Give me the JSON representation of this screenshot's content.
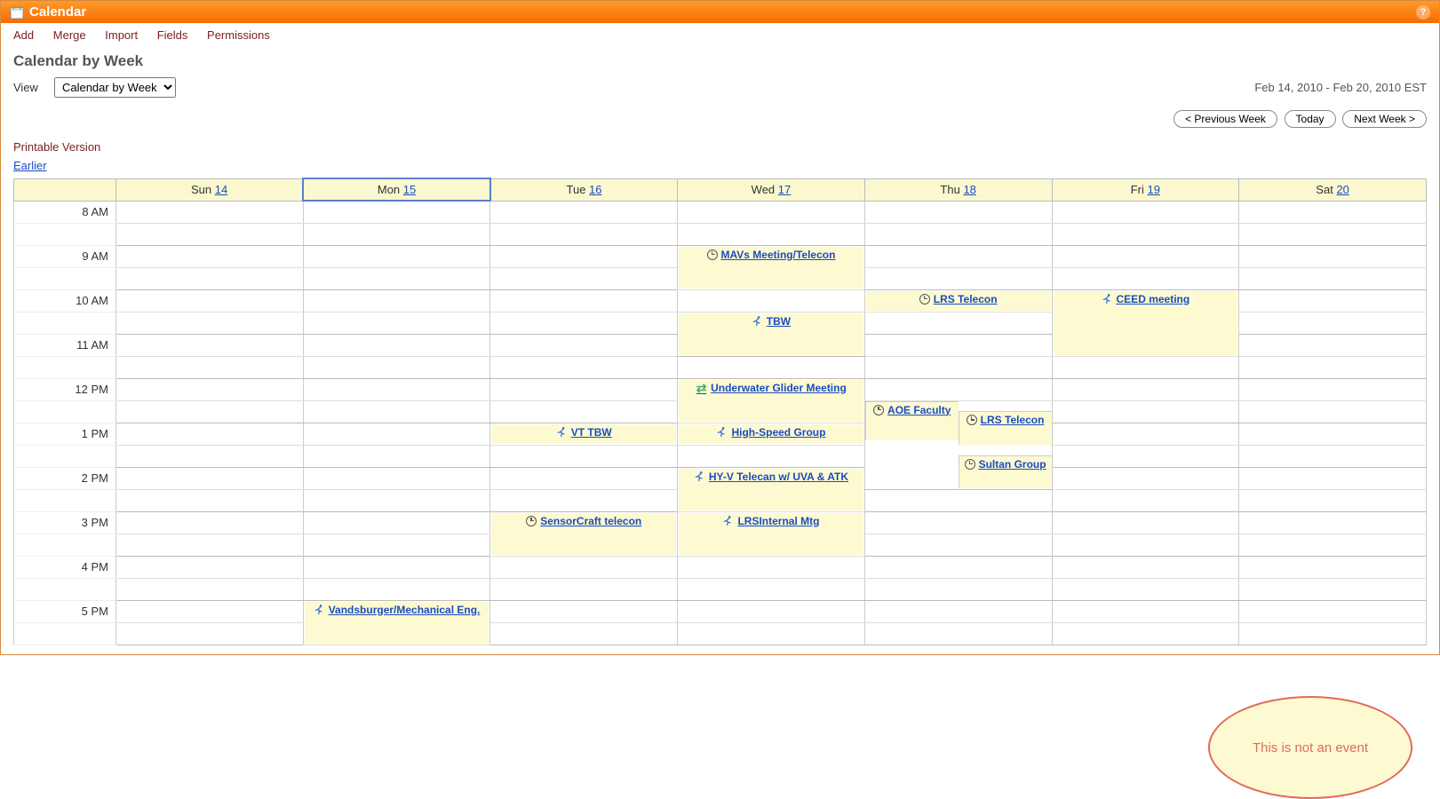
{
  "titlebar": {
    "title": "Calendar"
  },
  "menubar": [
    "Add",
    "Merge",
    "Import",
    "Fields",
    "Permissions"
  ],
  "sectionTitle": "Calendar by Week",
  "viewLabel": "View",
  "viewOptions": [
    "Calendar by Week"
  ],
  "viewSelected": "Calendar by Week",
  "dateRange": "Feb 14, 2010 - Feb 20, 2010 EST",
  "nav": {
    "prev": "< Previous Week",
    "today": "Today",
    "next": "Next Week >"
  },
  "printable": "Printable Version",
  "earlier": "Earlier",
  "days": [
    {
      "label": "Sun",
      "num": "14"
    },
    {
      "label": "Mon",
      "num": "15",
      "selected": true
    },
    {
      "label": "Tue",
      "num": "16"
    },
    {
      "label": "Wed",
      "num": "17"
    },
    {
      "label": "Thu",
      "num": "18"
    },
    {
      "label": "Fri",
      "num": "19"
    },
    {
      "label": "Sat",
      "num": "20"
    }
  ],
  "hours": [
    "8 AM",
    "9 AM",
    "10 AM",
    "11 AM",
    "12 PM",
    "1 PM",
    "2 PM",
    "3 PM",
    "4 PM",
    "5 PM"
  ],
  "events": {
    "mon_1700_2": {
      "icon": "run",
      "label": "Vandsburger/Mechanical Eng."
    },
    "tue_1300_1": {
      "icon": "run",
      "label": "VT TBW"
    },
    "tue_1500_2": {
      "icon": "clock",
      "label": "SensorCraft telecon"
    },
    "wed_0900_2": {
      "icon": "clock",
      "label": "MAVs Meeting/Telecon"
    },
    "wed_1030_2": {
      "icon": "run",
      "label": "TBW"
    },
    "wed_1200_2": {
      "icon": "swap",
      "label": "Underwater Glider Meeting"
    },
    "wed_1300_1": {
      "icon": "run",
      "label": "High-Speed Group"
    },
    "wed_1400_2": {
      "icon": "run",
      "label": "HY-V Telecan w/ UVA & ATK"
    },
    "wed_1500_2": {
      "icon": "run",
      "label": "LRSInternal Mtg"
    },
    "thu_1000_1": {
      "icon": "clock",
      "label": "LRS Telecon"
    },
    "thu_1230_aoe": {
      "icon": "clock",
      "label": "AOE Faculty"
    },
    "thu_1300_lrs": {
      "icon": "clock",
      "label": "LRS Telecon"
    },
    "thu_1400_sultan": {
      "icon": "clock",
      "label": "Sultan Group"
    },
    "fri_1000_3": {
      "icon": "run",
      "label": "CEED meeting"
    }
  },
  "annotation": "This is not an event"
}
